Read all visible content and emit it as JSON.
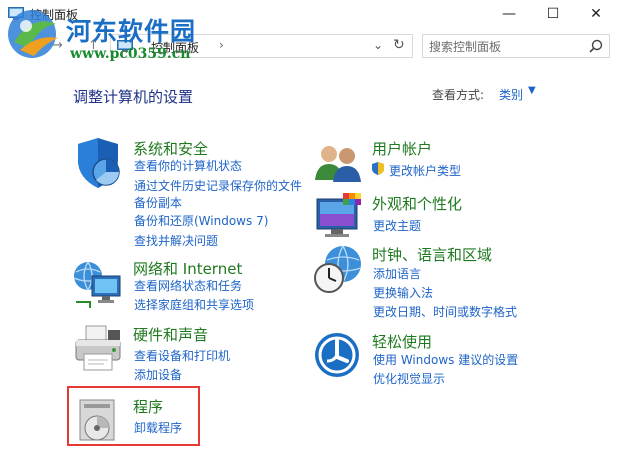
{
  "window": {
    "title": "控制面板",
    "minimize_glyph": "—",
    "maximize_glyph": "☐",
    "close_glyph": "✕"
  },
  "watermark": {
    "title": "河东软件园",
    "url": "www.pc0359.cn"
  },
  "nav": {
    "back_glyph": "←",
    "forward_glyph": "→",
    "up_glyph": "↑",
    "breadcrumb": "控制面板",
    "separator": "›",
    "dropdown_glyph": "⌄",
    "refresh_glyph": "↻",
    "search_placeholder": "搜索控制面板"
  },
  "header": {
    "title": "调整计算机的设置",
    "view_by_label": "查看方式:",
    "view_by_value": "类别",
    "caret": "▼"
  },
  "categories_left": [
    {
      "title": "系统和安全",
      "icon": "shield-icon",
      "links": [
        "查看你的计算机状态",
        "通过文件历史记录保存你的文件",
        "备份副本",
        "备份和还原(Windows 7)",
        "查找并解决问题"
      ]
    },
    {
      "title": "网络和 Internet",
      "icon": "network-globe-icon",
      "links": [
        "查看网络状态和任务",
        "选择家庭组和共享选项"
      ]
    },
    {
      "title": "硬件和声音",
      "icon": "printer-icon",
      "links": [
        "查看设备和打印机",
        "添加设备"
      ]
    },
    {
      "title": "程序",
      "icon": "programs-disc-icon",
      "links": [
        "卸载程序"
      ]
    }
  ],
  "categories_right": [
    {
      "title": "用户帐户",
      "icon": "users-icon",
      "links": [
        "更改帐户类型"
      ]
    },
    {
      "title": "外观和个性化",
      "icon": "monitor-palette-icon",
      "links": [
        "更改主题"
      ]
    },
    {
      "title": "时钟、语言和区域",
      "icon": "clock-globe-icon",
      "links": [
        "添加语言",
        "更换输入法",
        "更改日期、时间或数字格式"
      ]
    },
    {
      "title": "轻松使用",
      "icon": "ease-of-access-icon",
      "links": [
        "使用 Windows 建议的设置",
        "优化视觉显示"
      ]
    }
  ],
  "colors": {
    "category_title": "#1f7a1f",
    "link": "#1e64c8",
    "heading": "#1e3287",
    "highlight": "#e53935"
  }
}
